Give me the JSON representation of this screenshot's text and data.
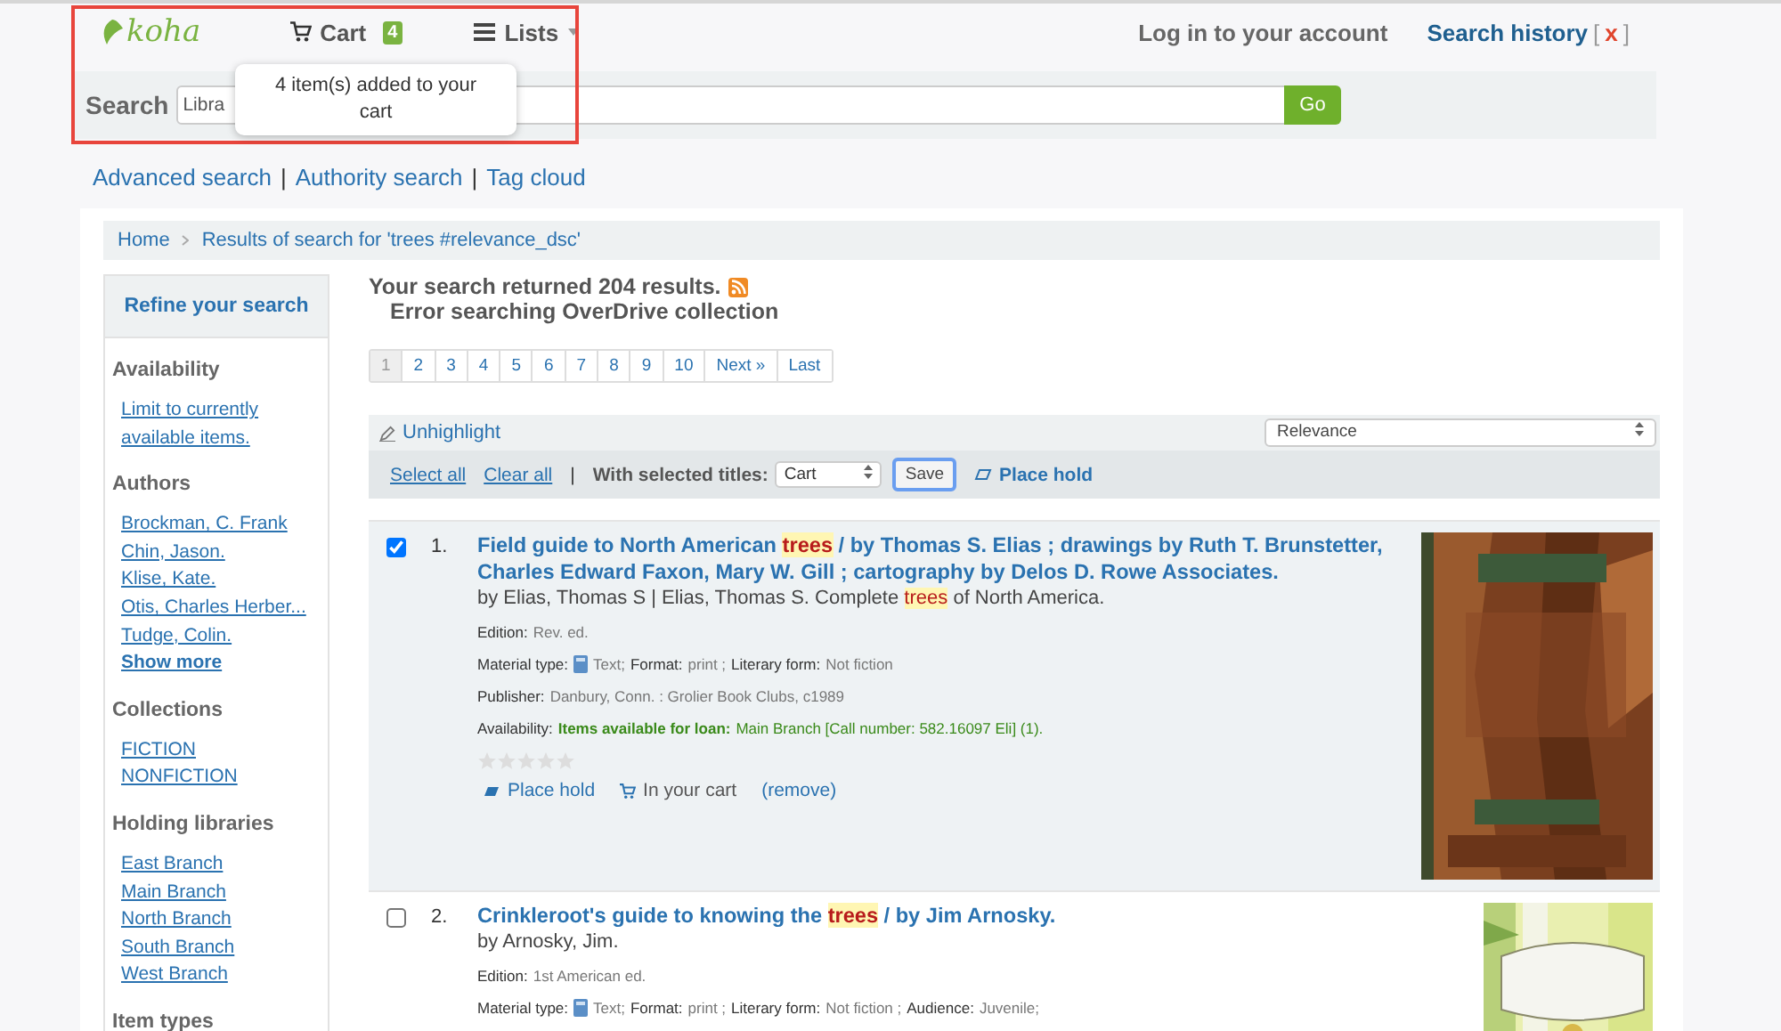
{
  "header": {
    "logo": "koha",
    "cart": {
      "label": "Cart",
      "count": "4"
    },
    "lists": "Lists",
    "login": "Log in to your account",
    "search_history": "Search history",
    "clear_history": "x",
    "bracket_open": "[",
    "bracket_close": "]"
  },
  "tooltip": "4 item(s) added to your cart",
  "search": {
    "label": "Search",
    "scope": "Libra",
    "button": "Go"
  },
  "search_links": [
    "Advanced search",
    "Authority search",
    "Tag cloud"
  ],
  "link_separator": "|",
  "breadcrumb": [
    "Home",
    "Results of search for 'trees #relevance_dsc'"
  ],
  "sidebar": {
    "title": "Refine your search",
    "sections": [
      {
        "heading": "Availability",
        "links": [
          {
            "text": "Limit to currently available items.",
            "bold": false
          }
        ]
      },
      {
        "heading": "Authors",
        "links": [
          {
            "text": "Brockman, C. Frank",
            "bold": false
          },
          {
            "text": "Chin, Jason.",
            "bold": false
          },
          {
            "text": "Klise, Kate.",
            "bold": false
          },
          {
            "text": "Otis, Charles Herber...",
            "bold": false
          },
          {
            "text": "Tudge, Colin.",
            "bold": false
          },
          {
            "text": "Show more",
            "bold": true
          }
        ]
      },
      {
        "heading": "Collections",
        "links": [
          {
            "text": "FICTION",
            "bold": false
          },
          {
            "text": "NONFICTION",
            "bold": false
          }
        ]
      },
      {
        "heading": "Holding libraries",
        "links": [
          {
            "text": "East Branch",
            "bold": false
          },
          {
            "text": "Main Branch",
            "bold": false
          },
          {
            "text": "North Branch",
            "bold": false
          },
          {
            "text": "South Branch",
            "bold": false
          },
          {
            "text": "West Branch",
            "bold": false
          }
        ]
      },
      {
        "heading": "Item types"
      }
    ]
  },
  "summary": "Your search returned 204 results.",
  "error": "Error searching OverDrive collection",
  "pagination": [
    {
      "label": "1",
      "selected": true
    },
    {
      "label": "2",
      "selected": false
    },
    {
      "label": "3",
      "selected": false
    },
    {
      "label": "4",
      "selected": false
    },
    {
      "label": "5",
      "selected": false
    },
    {
      "label": "6",
      "selected": false
    },
    {
      "label": "7",
      "selected": false
    },
    {
      "label": "8",
      "selected": false
    },
    {
      "label": "9",
      "selected": false
    },
    {
      "label": "10",
      "selected": false
    },
    {
      "label": "Next »",
      "selected": false
    },
    {
      "label": "Last",
      "selected": false
    }
  ],
  "unhighlight": "Unhighlight",
  "sort": "Relevance",
  "toolbar": {
    "select_all": "Select all",
    "clear_all": "Clear all",
    "separator": "|",
    "with_selected": "With selected titles:",
    "action": "Cart",
    "save": "Save",
    "place_hold": "Place hold"
  },
  "results": [
    {
      "checked": true,
      "number": "1.",
      "title": [
        {
          "text": "Field guide to North American ",
          "highlight": false
        },
        {
          "text": "trees",
          "highlight": true
        },
        {
          "text": " / by Thomas S. Elias ; drawings by Ruth T. Brunstetter, Charles Edward Faxon, Mary W. Gill ; cartography by Delos D. Rowe Associates.",
          "highlight": false
        }
      ],
      "byline": [
        {
          "text": "by Elias, Thomas S | Elias, Thomas S. Complete ",
          "highlight": false
        },
        {
          "text": "trees",
          "highlight": true
        },
        {
          "text": " of North America.",
          "highlight": false
        }
      ],
      "lines": [
        {
          "kind": "field",
          "parts": [
            {
              "label": "Edition:",
              "value": "Rev. ed.",
              "icon": false
            }
          ]
        },
        {
          "kind": "field",
          "parts": [
            {
              "label": "Material type:",
              "value": "Text;",
              "icon": true
            },
            {
              "label": "Format:",
              "value": "print ;",
              "icon": false
            },
            {
              "label": "Literary form:",
              "value": "Not fiction",
              "icon": false
            }
          ]
        },
        {
          "kind": "field",
          "parts": [
            {
              "label": "Publisher:",
              "value": "Danbury, Conn. : Grolier Book Clubs, c1989",
              "icon": false
            }
          ]
        },
        {
          "kind": "availability",
          "label": "Availability:",
          "status": "Items available for loan:",
          "value": "Main Branch [Call number: 582.16097 Eli] (1)."
        }
      ],
      "stars": 0,
      "actions": {
        "place_hold": "Place hold",
        "in_cart": "In your cart",
        "remove": "(remove)"
      },
      "cover": {
        "kind": "picture"
      }
    },
    {
      "checked": false,
      "number": "2.",
      "title": [
        {
          "text": "Crinkleroot's guide to knowing the ",
          "highlight": false
        },
        {
          "text": "trees",
          "highlight": true
        },
        {
          "text": " / by Jim Arnosky.",
          "highlight": false
        }
      ],
      "byline": [
        {
          "text": "by Arnosky, Jim.",
          "highlight": false
        }
      ],
      "lines": [
        {
          "kind": "field",
          "parts": [
            {
              "label": "Edition:",
              "value": "1st American ed.",
              "icon": false
            }
          ]
        },
        {
          "kind": "field",
          "parts": [
            {
              "label": "Material type:",
              "value": "Text;",
              "icon": true
            },
            {
              "label": "Format:",
              "value": "print ;",
              "icon": false
            },
            {
              "label": "Literary form:",
              "value": "Not fiction ;",
              "icon": false
            },
            {
              "label": "Audience:",
              "value": "Juvenile;",
              "icon": false
            }
          ]
        }
      ],
      "cover": {
        "kind": "picture"
      }
    }
  ]
}
